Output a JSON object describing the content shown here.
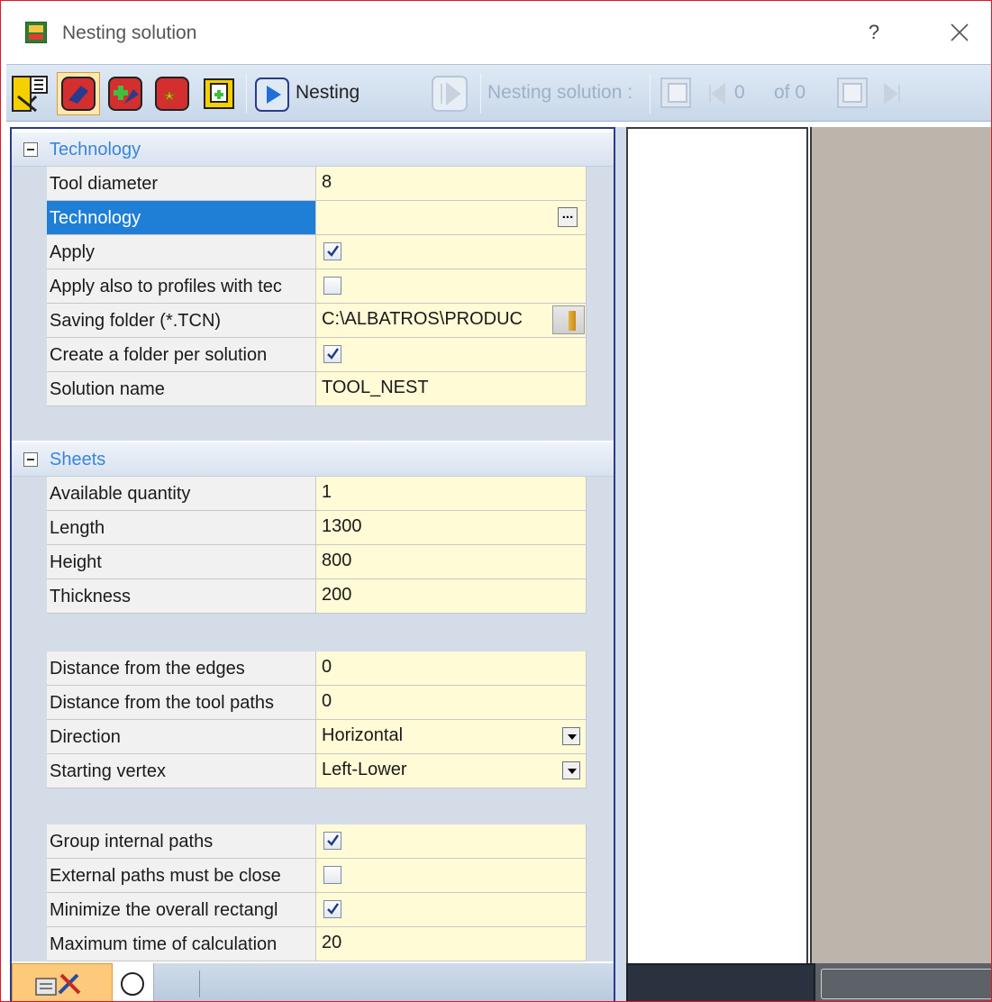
{
  "window": {
    "title": "Nesting solution",
    "help_label": "?"
  },
  "toolbar": {
    "nesting_label": "Nesting",
    "solution_label": "Nesting solution :",
    "current_index": "0",
    "of_total": "of 0"
  },
  "technology_group": {
    "label": "Technology",
    "rows": [
      {
        "label": "Tool diameter",
        "value": "8"
      },
      {
        "label": "Technology",
        "value": ""
      },
      {
        "label": "Apply",
        "checked": true
      },
      {
        "label": "Apply also to profiles with tec",
        "checked": false
      },
      {
        "label": "Saving folder (*.TCN)",
        "value": "C:\\ALBATROS\\PRODUC"
      },
      {
        "label": "Create a folder per solution",
        "checked": true
      },
      {
        "label": "Solution name",
        "value": "TOOL_NEST"
      }
    ]
  },
  "sheets_group": {
    "label": "Sheets",
    "rows": [
      {
        "label": "Available quantity",
        "value": "1"
      },
      {
        "label": "Length",
        "value": "1300"
      },
      {
        "label": "Height",
        "value": "800"
      },
      {
        "label": "Thickness",
        "value": "200"
      }
    ]
  },
  "placement": {
    "rows": [
      {
        "label": "Distance from the edges",
        "value": "0"
      },
      {
        "label": "Distance from the tool paths",
        "value": "0"
      },
      {
        "label": "Direction",
        "value": "Horizontal"
      },
      {
        "label": "Starting vertex",
        "value": "Left-Lower"
      }
    ]
  },
  "options": {
    "rows": [
      {
        "label": "Group internal paths",
        "checked": true
      },
      {
        "label": "External paths must be close",
        "checked": false
      },
      {
        "label": "Minimize the overall rectangl",
        "checked": true
      },
      {
        "label": "Maximum time of calculation",
        "value": "20"
      }
    ]
  },
  "colors": {
    "selected_row": "#1f7fd6",
    "value_background": "#fffbd6",
    "group_text": "#3a86d8",
    "active_tab": "#fdc97a"
  }
}
